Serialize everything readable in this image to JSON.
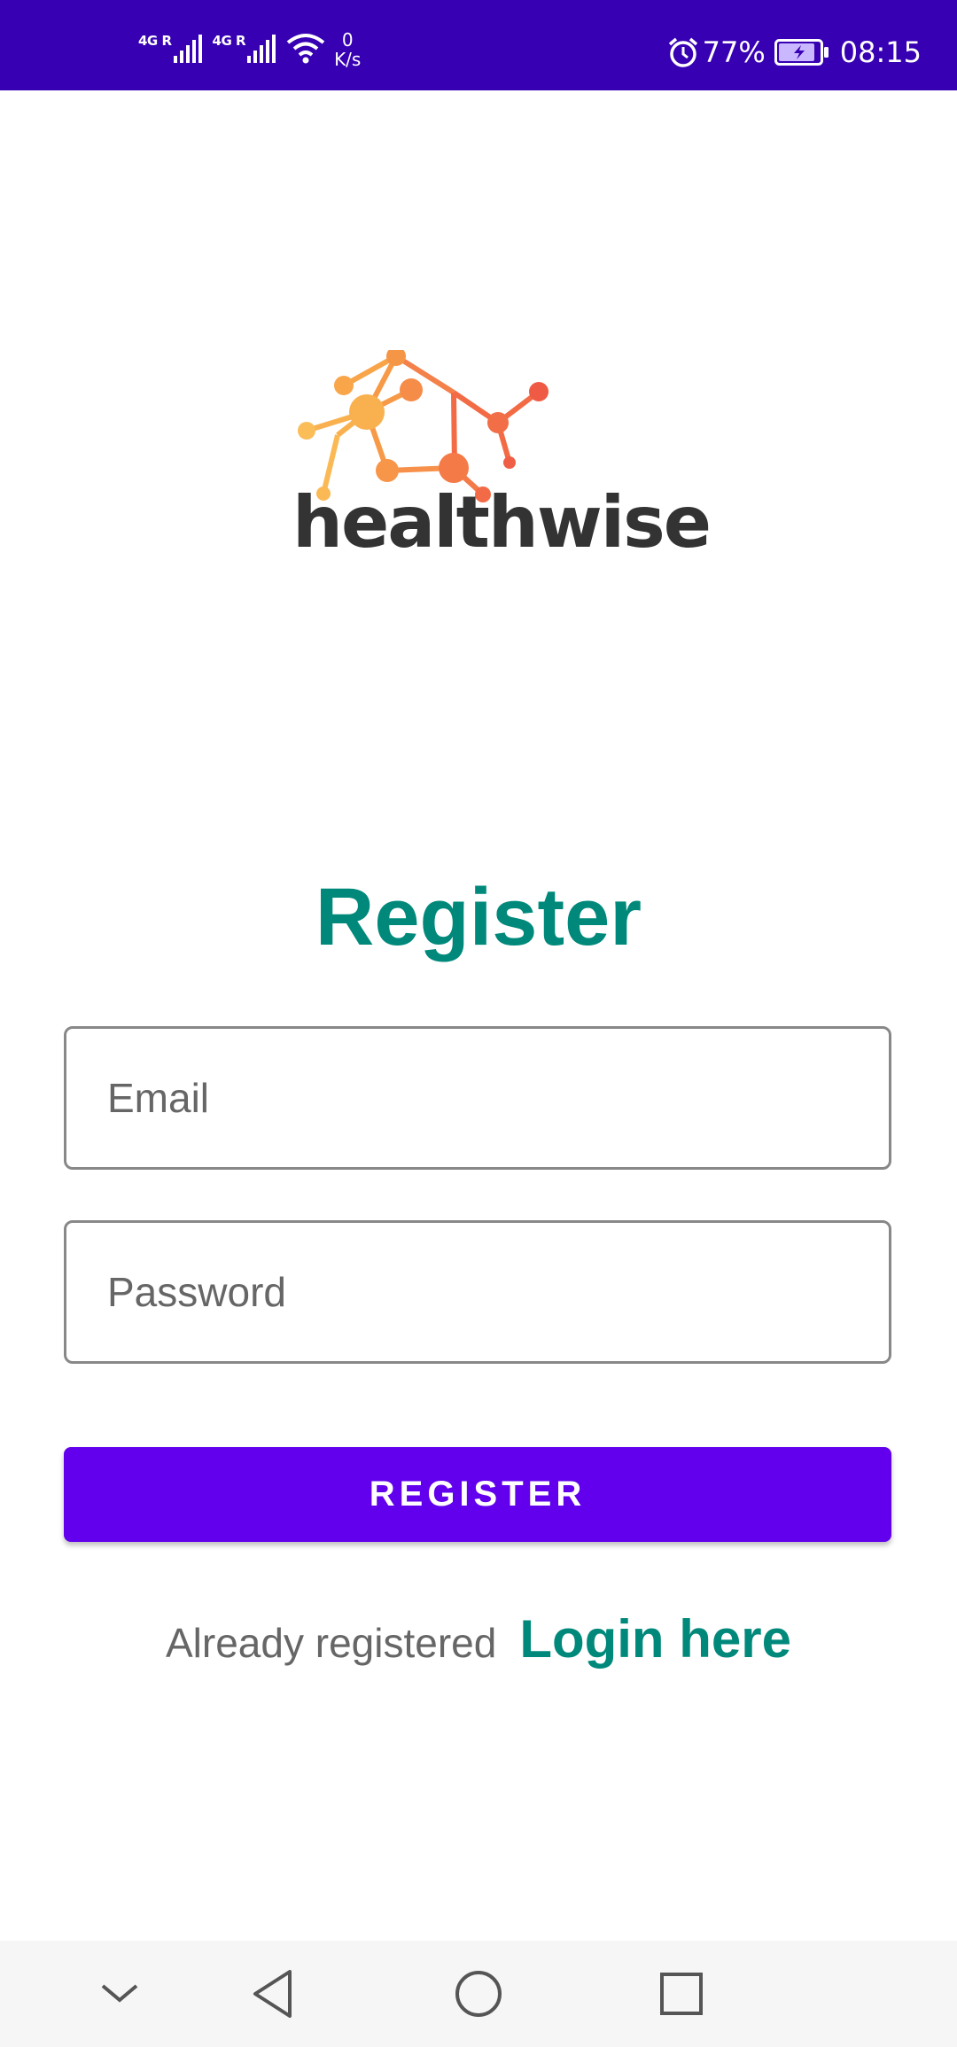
{
  "status_bar": {
    "signal_1_label": "4G R",
    "signal_2_label": "4G R",
    "net_speed_value": "0",
    "net_speed_unit": "K/s",
    "battery_percent": "77%",
    "time": "08:15",
    "background_color": "#3700b3"
  },
  "logo": {
    "text": "healthwise",
    "icon": "network-nodes-logo"
  },
  "register_form": {
    "title": "Register",
    "email_placeholder": "Email",
    "email_value": "",
    "password_placeholder": "Password",
    "password_value": "",
    "register_button_label": "REGISTER",
    "already_registered_text": "Already registered",
    "login_link_text": "Login here"
  },
  "colors": {
    "accent_teal": "#00897b",
    "button_purple": "#6200ee"
  },
  "nav_bar": {
    "icons": [
      "chevron-down-icon",
      "back-icon",
      "home-icon",
      "recents-icon"
    ]
  }
}
